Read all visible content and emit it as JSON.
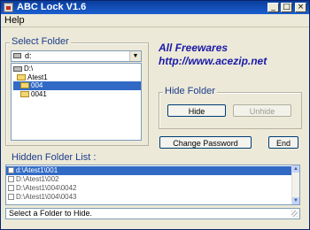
{
  "window": {
    "title": "ABC Lock V1.6"
  },
  "menu": {
    "help": "Help"
  },
  "select_folder": {
    "label": "Select Folder",
    "drive": "d:",
    "tree": [
      {
        "label": "D:\\",
        "icon": "drive-icon",
        "selected": false
      },
      {
        "label": "Atest1",
        "icon": "folder-icon",
        "selected": false
      },
      {
        "label": "004",
        "icon": "folder-icon",
        "selected": true
      },
      {
        "label": "0041",
        "icon": "folder-icon",
        "selected": false
      }
    ]
  },
  "promo": {
    "line1": "All Freewares",
    "line2": "http://www.acezip.net"
  },
  "hide_folder": {
    "label": "Hide Folder",
    "hide_button": "Hide",
    "unhide_button": "Unhide"
  },
  "buttons": {
    "change_password": "Change Password",
    "end": "End"
  },
  "hidden_list": {
    "label": "Hidden Folder List :",
    "items": [
      {
        "path": "d:\\Atest1\\001",
        "selected": true
      },
      {
        "path": "D:\\Atest1\\002",
        "selected": false
      },
      {
        "path": "D:\\Atest1\\004\\0042",
        "selected": false
      },
      {
        "path": "D:\\Atest1\\004\\0043",
        "selected": false
      }
    ]
  },
  "status": "Select a Folder to Hide."
}
